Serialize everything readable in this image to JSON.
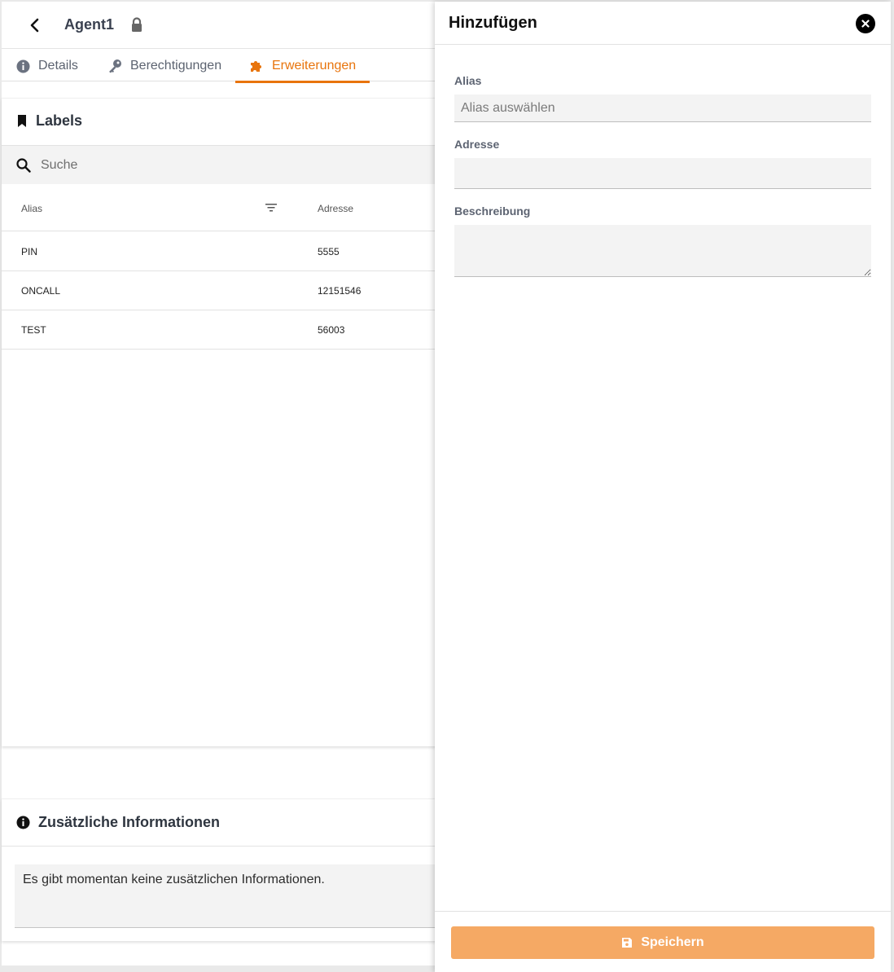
{
  "header": {
    "title": "Agent1"
  },
  "tabs": [
    {
      "label": "Details",
      "icon": "info-icon"
    },
    {
      "label": "Berechtigungen",
      "icon": "key-icon"
    },
    {
      "label": "Erweiterungen",
      "icon": "puzzle-icon",
      "active": true
    }
  ],
  "labels_section": {
    "title": "Labels",
    "search_placeholder": "Suche",
    "columns": {
      "alias": "Alias",
      "adresse": "Adresse"
    },
    "rows": [
      {
        "alias": "PIN",
        "adresse": "5555"
      },
      {
        "alias": "ONCALL",
        "adresse": "12151546"
      },
      {
        "alias": "TEST",
        "adresse": "56003"
      }
    ]
  },
  "info_section": {
    "title": "Zusätzliche Informationen",
    "text": "Es gibt momentan keine zusätzlichen Informationen."
  },
  "drawer": {
    "title": "Hinzufügen",
    "alias_label": "Alias",
    "alias_placeholder": "Alias auswählen",
    "adresse_label": "Adresse",
    "adresse_value": "",
    "beschreibung_label": "Beschreibung",
    "beschreibung_value": "",
    "save_label": "Speichern"
  },
  "colors": {
    "accent": "#e8740c",
    "save_button": "#f5a964"
  }
}
